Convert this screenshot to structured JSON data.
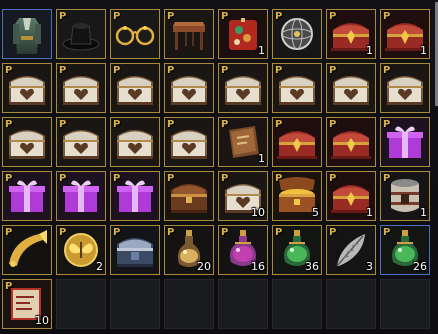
{
  "inventory": {
    "badge_label": "P",
    "slots": [
      {
        "item": "armor-set-icon",
        "frame": "blue",
        "badge": false,
        "count": ""
      },
      {
        "item": "top-hat-icon",
        "frame": "gold",
        "badge": true,
        "count": ""
      },
      {
        "item": "gold-glasses-icon",
        "frame": "gold",
        "badge": true,
        "count": ""
      },
      {
        "item": "wooden-table-icon",
        "frame": "gold",
        "badge": true,
        "count": ""
      },
      {
        "item": "red-ornament-box-icon",
        "frame": "gold",
        "badge": true,
        "count": "1"
      },
      {
        "item": "compass-sphere-icon",
        "frame": "gold",
        "badge": true,
        "count": ""
      },
      {
        "item": "red-treasure-chest-icon",
        "frame": "gold",
        "badge": true,
        "count": "1"
      },
      {
        "item": "red-treasure-chest-icon",
        "frame": "gold",
        "badge": true,
        "count": "1"
      },
      {
        "item": "silver-heart-chest-icon",
        "frame": "gold",
        "badge": true,
        "count": ""
      },
      {
        "item": "silver-heart-chest-icon",
        "frame": "gold",
        "badge": true,
        "count": ""
      },
      {
        "item": "silver-heart-chest-icon",
        "frame": "gold",
        "badge": true,
        "count": ""
      },
      {
        "item": "silver-heart-chest-icon",
        "frame": "gold",
        "badge": true,
        "count": ""
      },
      {
        "item": "silver-heart-chest-icon",
        "frame": "gold",
        "badge": true,
        "count": ""
      },
      {
        "item": "silver-heart-chest-icon",
        "frame": "gold",
        "badge": true,
        "count": ""
      },
      {
        "item": "silver-heart-chest-icon",
        "frame": "gold",
        "badge": true,
        "count": ""
      },
      {
        "item": "silver-heart-chest-icon",
        "frame": "gold",
        "badge": true,
        "count": ""
      },
      {
        "item": "silver-heart-chest-icon",
        "frame": "gold",
        "badge": true,
        "count": ""
      },
      {
        "item": "silver-heart-chest-icon",
        "frame": "gold",
        "badge": true,
        "count": ""
      },
      {
        "item": "silver-heart-chest-icon",
        "frame": "gold",
        "badge": true,
        "count": ""
      },
      {
        "item": "silver-heart-chest-icon",
        "frame": "gold",
        "badge": true,
        "count": ""
      },
      {
        "item": "brown-book-icon",
        "frame": "gold",
        "badge": true,
        "count": "1"
      },
      {
        "item": "red-treasure-chest-icon",
        "frame": "gold",
        "badge": true,
        "count": ""
      },
      {
        "item": "red-treasure-chest-icon",
        "frame": "gold",
        "badge": true,
        "count": ""
      },
      {
        "item": "purple-gift-box-icon",
        "frame": "gold",
        "badge": true,
        "count": ""
      },
      {
        "item": "purple-gift-box-icon",
        "frame": "gold",
        "badge": true,
        "count": ""
      },
      {
        "item": "purple-gift-box-icon",
        "frame": "gold",
        "badge": true,
        "count": ""
      },
      {
        "item": "purple-gift-box-icon",
        "frame": "gold",
        "badge": true,
        "count": ""
      },
      {
        "item": "wooden-chest-icon",
        "frame": "gold",
        "badge": true,
        "count": ""
      },
      {
        "item": "silver-heart-chest-icon",
        "frame": "gold",
        "badge": true,
        "count": "10"
      },
      {
        "item": "open-treasure-chest-icon",
        "frame": "gold",
        "badge": true,
        "count": "5"
      },
      {
        "item": "red-treasure-chest-icon",
        "frame": "gold",
        "badge": true,
        "count": "1"
      },
      {
        "item": "barrel-container-icon",
        "frame": "gold",
        "badge": true,
        "count": "1"
      },
      {
        "item": "golden-horn-icon",
        "frame": "gold",
        "badge": true,
        "count": ""
      },
      {
        "item": "butterfly-coin-icon",
        "frame": "gold",
        "badge": true,
        "count": "2"
      },
      {
        "item": "silver-blue-chest-icon",
        "frame": "gold",
        "badge": true,
        "count": ""
      },
      {
        "item": "potion-bottle-icon",
        "frame": "gold",
        "badge": true,
        "count": "20"
      },
      {
        "item": "purple-potion-icon",
        "frame": "gold",
        "badge": true,
        "count": "16"
      },
      {
        "item": "green-potion-icon",
        "frame": "gold",
        "badge": true,
        "count": "36"
      },
      {
        "item": "silver-feather-icon",
        "frame": "gold",
        "badge": true,
        "count": "3"
      },
      {
        "item": "green-potion-icon",
        "frame": "blue",
        "badge": true,
        "count": "26"
      },
      {
        "item": "red-scroll-icon",
        "frame": "gold",
        "badge": true,
        "count": "10"
      },
      {
        "item": "",
        "frame": "empty",
        "badge": false,
        "count": ""
      },
      {
        "item": "",
        "frame": "empty",
        "badge": false,
        "count": ""
      },
      {
        "item": "",
        "frame": "empty",
        "badge": false,
        "count": ""
      },
      {
        "item": "",
        "frame": "empty",
        "badge": false,
        "count": ""
      },
      {
        "item": "",
        "frame": "empty",
        "badge": false,
        "count": ""
      },
      {
        "item": "",
        "frame": "empty",
        "badge": false,
        "count": ""
      },
      {
        "item": "",
        "frame": "empty",
        "badge": false,
        "count": ""
      }
    ]
  }
}
